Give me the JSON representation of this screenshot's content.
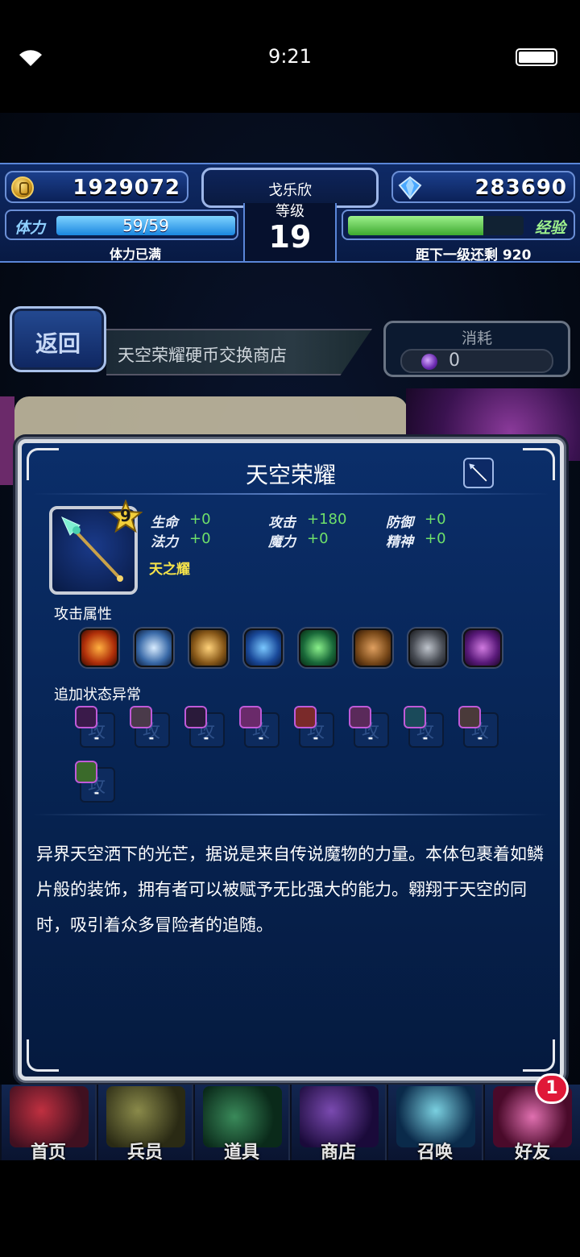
{
  "status_bar": {
    "time": "9:21"
  },
  "hud": {
    "gil": "1929072",
    "gems": "283690",
    "player_name": "戈乐欣",
    "level_label": "等级",
    "level": "19",
    "stamina_label": "体力",
    "stamina_text": "59/59",
    "stamina_fraction": 1.0,
    "stamina_status": "体力已满",
    "exp_label": "经验",
    "exp_fraction": 0.77,
    "exp_remaining": "距下一级还剩 920"
  },
  "shop": {
    "back_label": "返回",
    "title": "天空荣耀硬币交换商店",
    "cost_label": "消耗",
    "cost_value": "0"
  },
  "item": {
    "name": "天空荣耀",
    "rarity": "9",
    "type": "天之耀",
    "stats": [
      {
        "label": "生命",
        "value": "+0"
      },
      {
        "label": "法力",
        "value": "+0"
      },
      {
        "label": "攻击",
        "value": "+180"
      },
      {
        "label": "魔力",
        "value": "+0"
      },
      {
        "label": "防御",
        "value": "+0"
      },
      {
        "label": "精神",
        "value": "+0"
      }
    ],
    "attack_element_label": "攻击属性",
    "elements": [
      "fire-icon",
      "ice-icon",
      "lightning-icon",
      "water-icon",
      "wind-icon",
      "earth-icon",
      "holy-icon",
      "dark-icon"
    ],
    "ailment_label": "追加状态异常",
    "ailments": [
      {
        "icon": "poison-icon",
        "value": "-"
      },
      {
        "icon": "blind-icon",
        "value": "-"
      },
      {
        "icon": "sleep-icon",
        "value": "-"
      },
      {
        "icon": "silence-icon",
        "value": "-"
      },
      {
        "icon": "paralysis-icon",
        "value": "-"
      },
      {
        "icon": "confusion-icon",
        "value": "-"
      },
      {
        "icon": "disease-icon",
        "value": "-"
      },
      {
        "icon": "petrify-icon",
        "value": "-"
      },
      {
        "icon": "death-icon",
        "value": "-"
      }
    ],
    "description": "异界天空洒下的光芒，据说是来自传说魔物的力量。本体包裹着如鳞片般的装饰，拥有者可以被赋予无比强大的能力。翱翔于天空的同时，吸引着众多冒险者的追随。"
  },
  "nav": {
    "items": [
      "首页",
      "兵员",
      "道具",
      "商店",
      "召唤",
      "好友"
    ],
    "friends_badge": "1"
  },
  "colors": {
    "stat_value": "#6fe06a",
    "item_type": "#f5e34a",
    "badge": "#e01838"
  }
}
